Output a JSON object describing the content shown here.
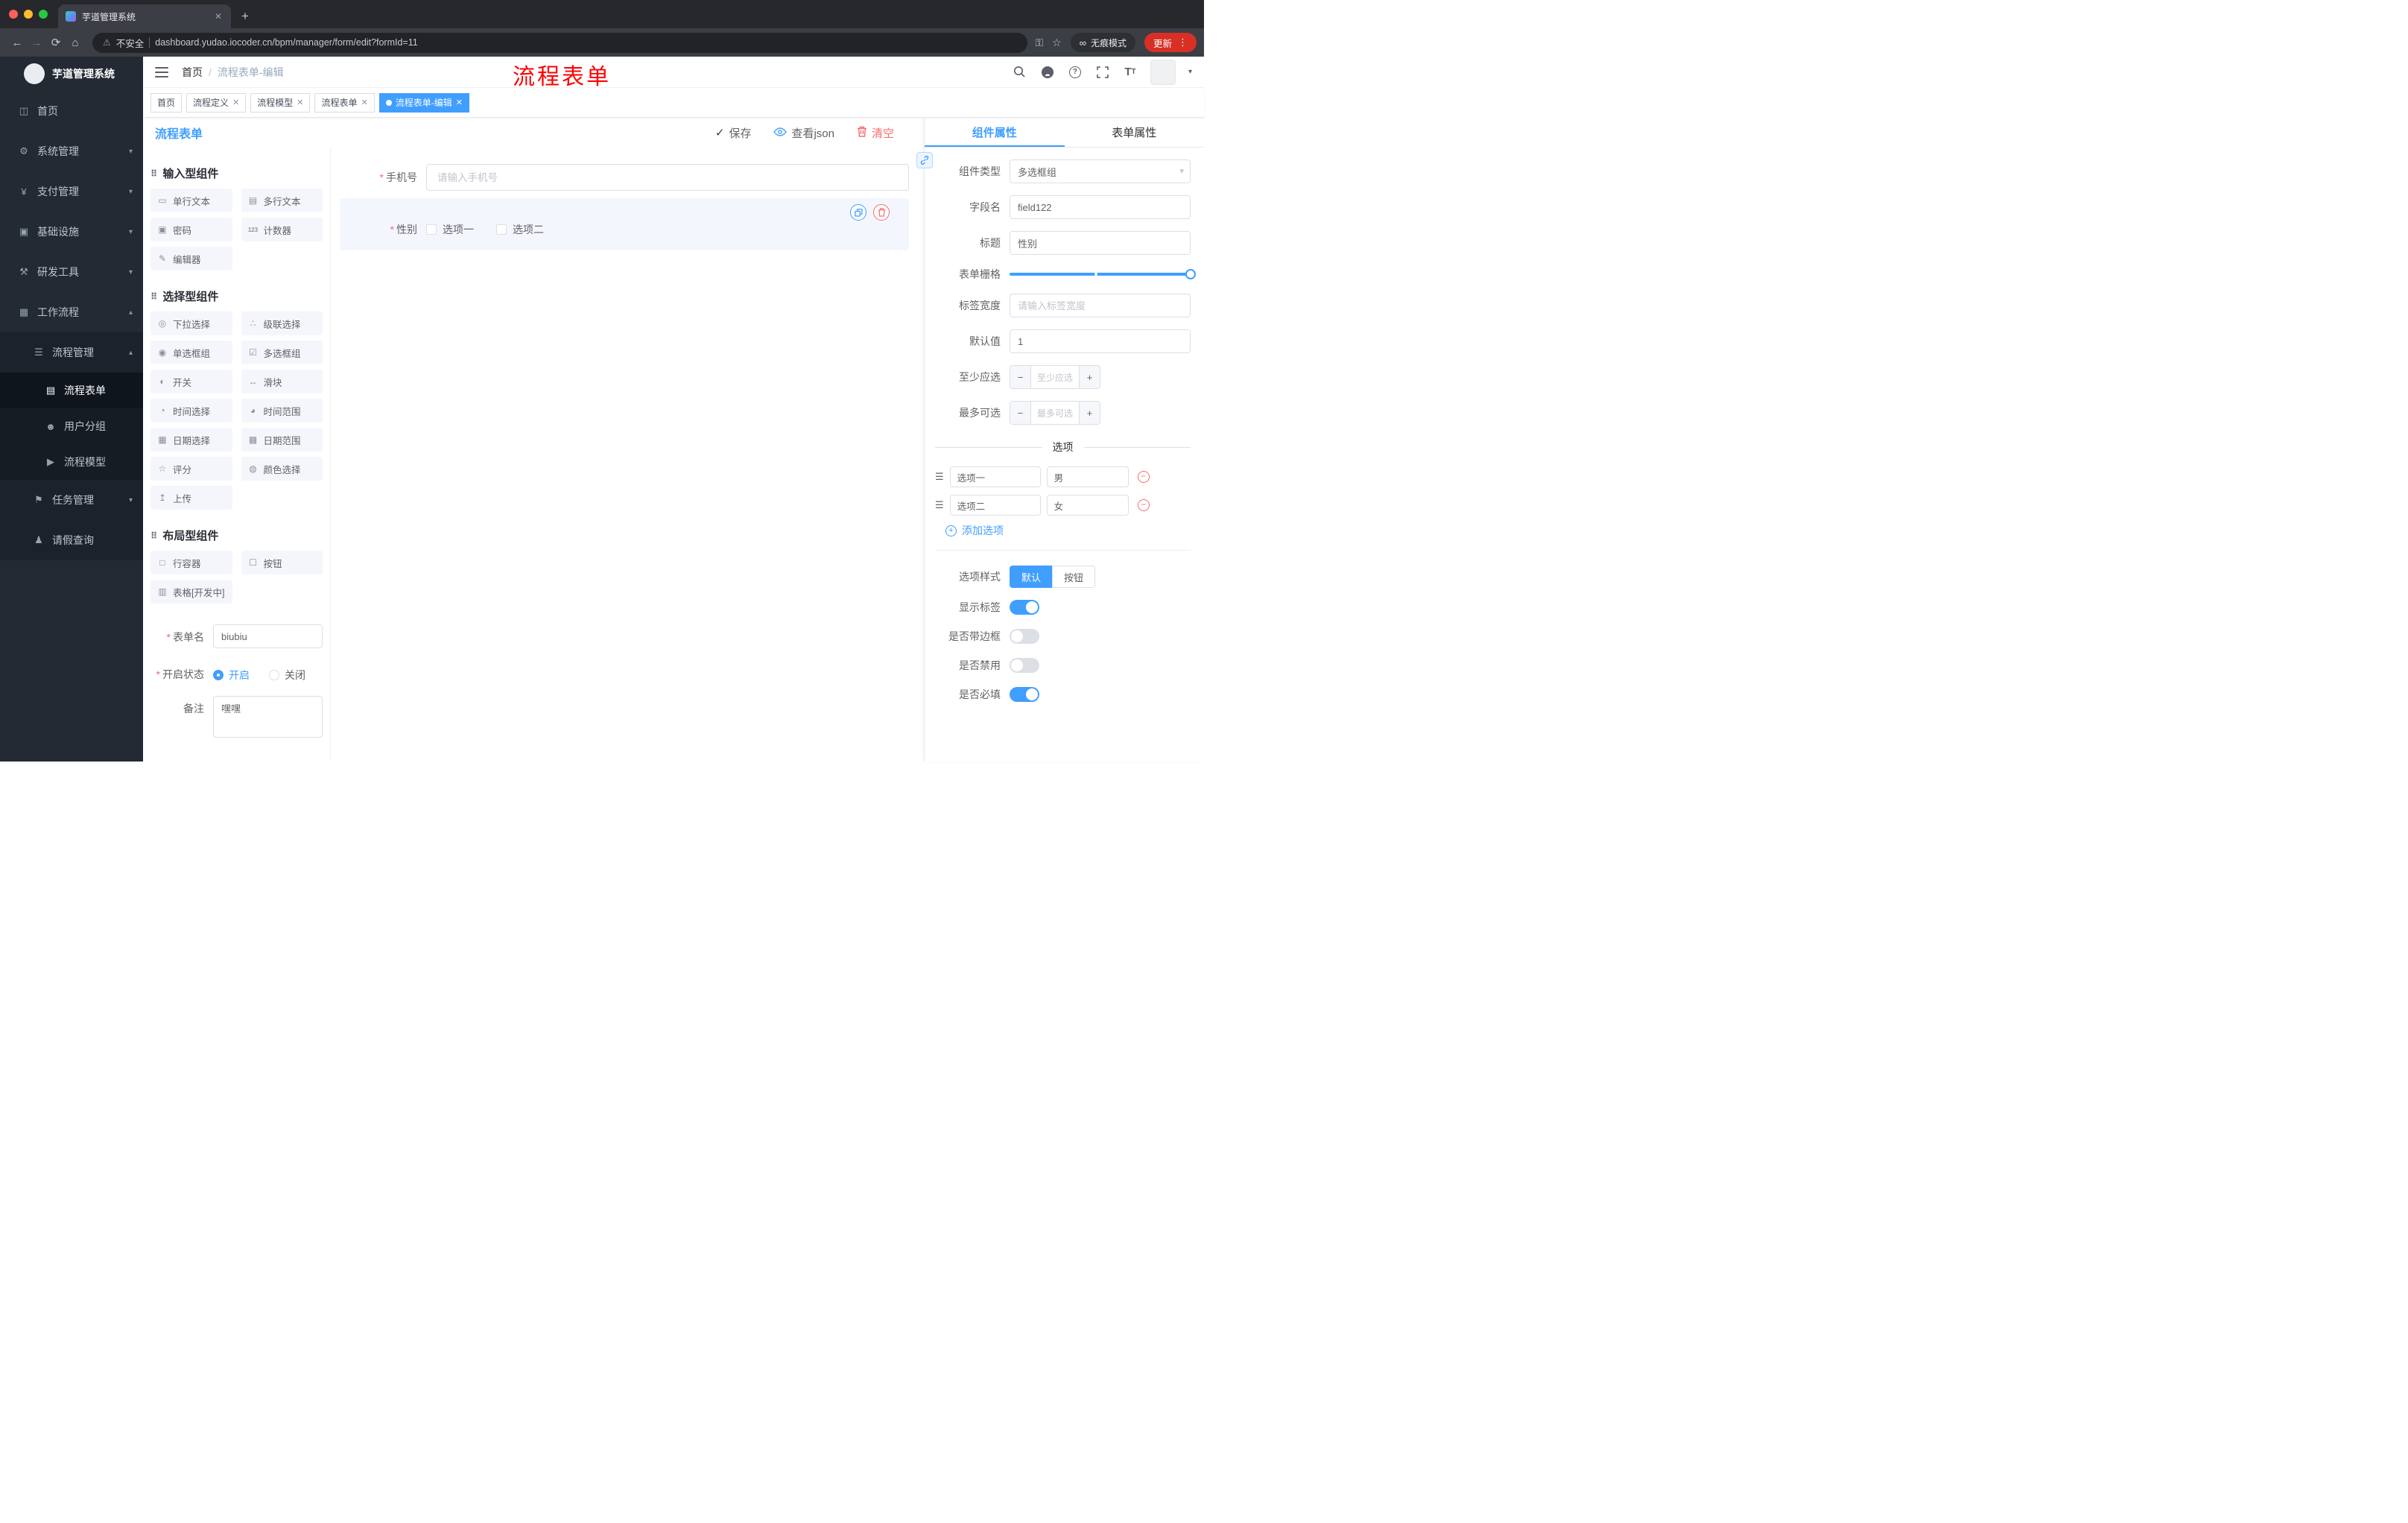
{
  "browser": {
    "tab_title": "芋道管理系统",
    "security": "不安全",
    "url": "dashboard.yudao.iocoder.cn/bpm/manager/form/edit?formId=11",
    "incognito": "无痕模式",
    "update": "更新"
  },
  "icons": {
    "close": "✕",
    "plus": "+",
    "back": "←",
    "forward": "→",
    "reload": "⟳",
    "home": "⌂",
    "warning": "⚠",
    "key": "⚿",
    "star": "☆",
    "glasses": "∞",
    "dots": "⋮",
    "chevron_down": "▾",
    "chevron_up": "▴",
    "question": "?",
    "grab": "⠿",
    "check": "✓",
    "drag": "☰",
    "minus": "−",
    "add": "+"
  },
  "annotation": "流程表单",
  "sidebar": {
    "title": "芋道管理系统",
    "menu": [
      {
        "label": "首页",
        "icon": "◫"
      },
      {
        "label": "系统管理",
        "icon": "⚙"
      },
      {
        "label": "支付管理",
        "icon": "¥"
      },
      {
        "label": "基础设施",
        "icon": "▣"
      },
      {
        "label": "研发工具",
        "icon": "⚒"
      },
      {
        "label": "工作流程",
        "icon": "▦"
      }
    ],
    "submenu_header": {
      "label": "流程管理",
      "icon": "☰"
    },
    "children": [
      {
        "label": "流程表单",
        "icon": "▤"
      },
      {
        "label": "用户分组",
        "icon": "☻"
      },
      {
        "label": "流程模型",
        "icon": "▶"
      }
    ],
    "tail": [
      {
        "label": "任务管理",
        "icon": "⚑"
      },
      {
        "label": "请假查询",
        "icon": "♟"
      }
    ]
  },
  "header": {
    "breadcrumb_home": "首页",
    "breadcrumb_sep": "/",
    "breadcrumb_current": "流程表单-编辑"
  },
  "tags": [
    {
      "label": "首页"
    },
    {
      "label": "流程定义"
    },
    {
      "label": "流程模型"
    },
    {
      "label": "流程表单"
    },
    {
      "label": "流程表单-编辑"
    }
  ],
  "designer": {
    "title": "流程表单",
    "actions": {
      "save": "保存",
      "view_json": "查看json",
      "clear": "清空"
    },
    "groups": {
      "input": {
        "title": "输入型组件",
        "items": [
          {
            "label": "单行文本",
            "icon": "▭"
          },
          {
            "label": "多行文本",
            "icon": "▤"
          },
          {
            "label": "密码",
            "icon": "▣"
          },
          {
            "label": "计数器",
            "icon": "123"
          },
          {
            "label": "编辑器",
            "icon": "✎"
          }
        ]
      },
      "select": {
        "title": "选择型组件",
        "items": [
          {
            "label": "下拉选择",
            "icon": "◎"
          },
          {
            "label": "级联选择",
            "icon": "∴"
          },
          {
            "label": "单选框组",
            "icon": "◉"
          },
          {
            "label": "多选框组",
            "icon": "☑"
          },
          {
            "label": "开关",
            "icon": "◐"
          },
          {
            "label": "滑块",
            "icon": "↔"
          },
          {
            "label": "时间选择",
            "icon": "◔"
          },
          {
            "label": "时间范围",
            "icon": "◕"
          },
          {
            "label": "日期选择",
            "icon": "▦"
          },
          {
            "label": "日期范围",
            "icon": "▩"
          },
          {
            "label": "评分",
            "icon": "☆"
          },
          {
            "label": "颜色选择",
            "icon": "◍"
          },
          {
            "label": "上传",
            "icon": "↥"
          }
        ]
      },
      "layout": {
        "title": "布局型组件",
        "items": [
          {
            "label": "行容器",
            "icon": "□"
          },
          {
            "label": "按钮",
            "icon": "☐"
          },
          {
            "label": "表格[开发中]",
            "icon": "▥"
          }
        ]
      }
    },
    "meta": {
      "name_label": "表单名",
      "name_value": "biubiu",
      "status_label": "开启状态",
      "status_on": "开启",
      "status_off": "关闭",
      "remark_label": "备注",
      "remark_value": "嘿嘿"
    },
    "canvas": {
      "phone_label": "手机号",
      "phone_placeholder": "请输入手机号",
      "gender_label": "性别",
      "gender_options": [
        "选项一",
        "选项二"
      ]
    }
  },
  "props": {
    "tab_component": "组件属性",
    "tab_form": "表单属性",
    "type_label": "组件类型",
    "type_value": "多选框组",
    "field_label": "字段名",
    "field_value": "field122",
    "title_label": "标题",
    "title_value": "性别",
    "grid_label": "表单栅格",
    "label_width_label": "标签宽度",
    "label_width_placeholder": "请输入标签宽度",
    "default_label": "默认值",
    "default_value": "1",
    "min_label": "至少应选",
    "min_placeholder": "至少应选",
    "max_label": "最多可选",
    "max_placeholder": "最多可选",
    "options_divider": "选项",
    "options": [
      {
        "label": "选项一",
        "value": "男"
      },
      {
        "label": "选项二",
        "value": "女"
      }
    ],
    "add_option": "添加选项",
    "style_label": "选项样式",
    "style_default": "默认",
    "style_button": "按钮",
    "toggles": [
      {
        "label": "显示标签",
        "on": true
      },
      {
        "label": "是否带边框",
        "on": false
      },
      {
        "label": "是否禁用",
        "on": false
      },
      {
        "label": "是否必填",
        "on": true
      }
    ]
  }
}
